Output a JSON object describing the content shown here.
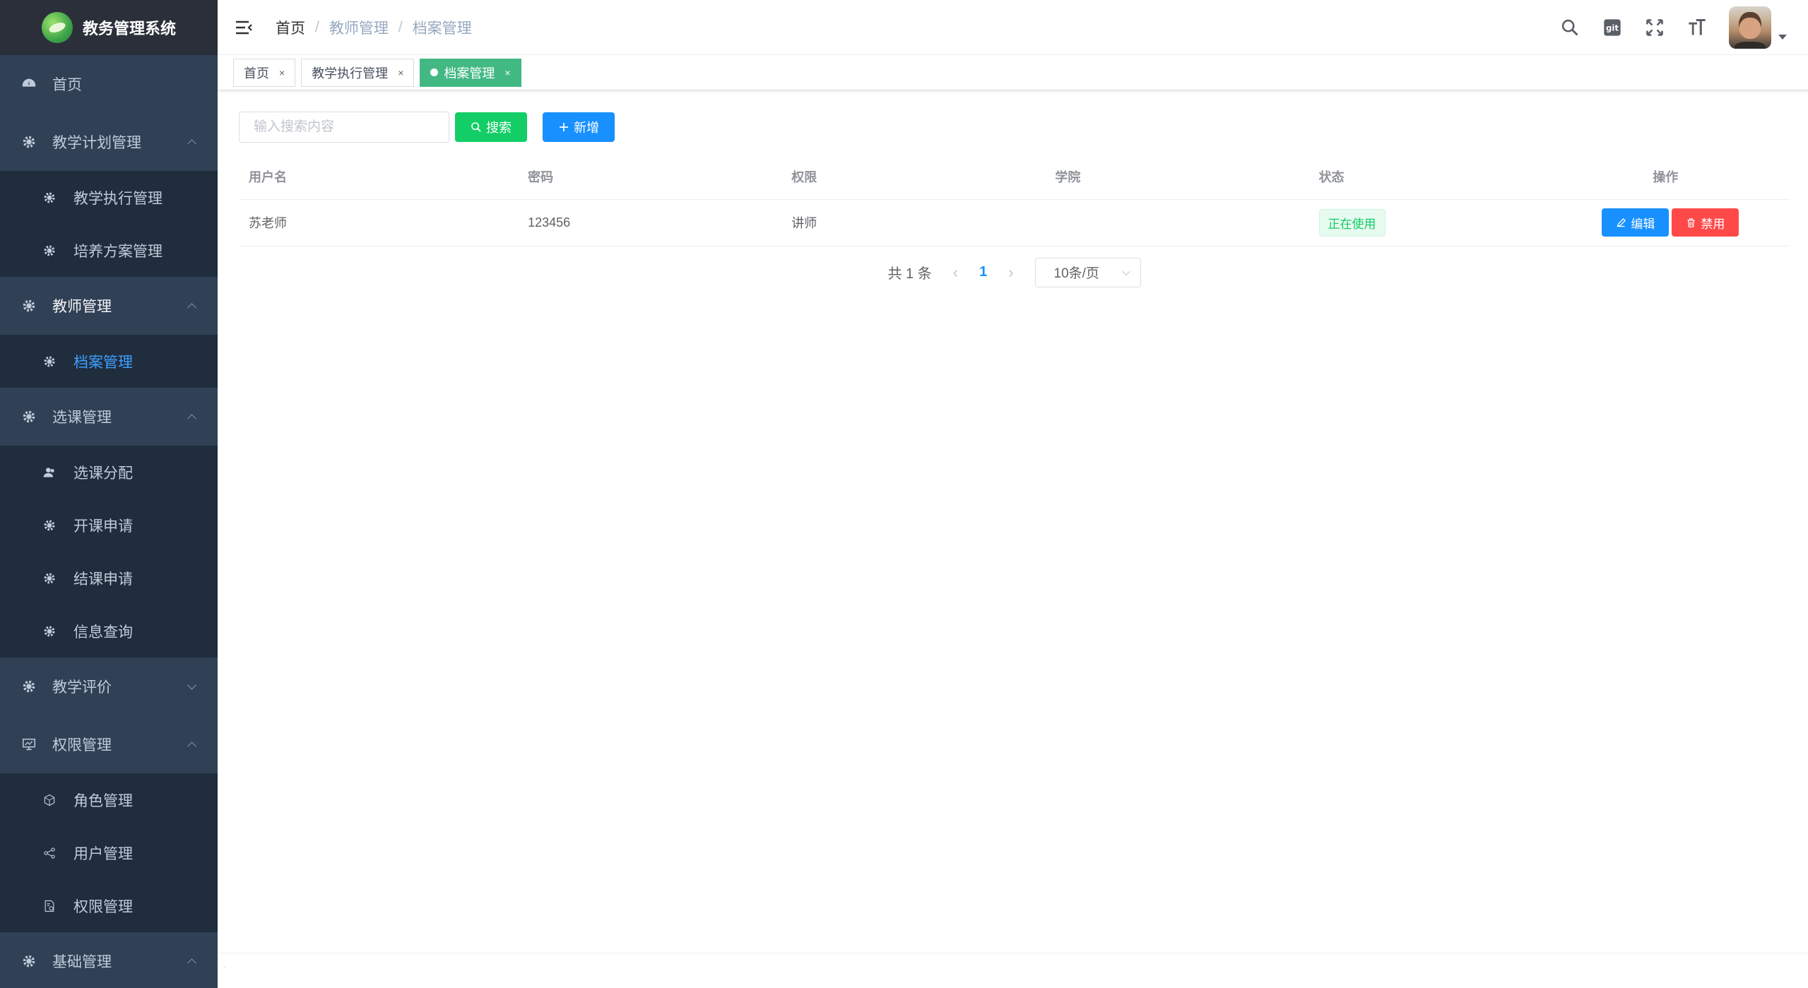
{
  "app": {
    "title": "教务管理系统"
  },
  "sidebar": {
    "items": [
      {
        "label": "首页"
      },
      {
        "label": "教学计划管理",
        "children": [
          {
            "label": "教学执行管理"
          },
          {
            "label": "培养方案管理"
          }
        ]
      },
      {
        "label": "教师管理",
        "children": [
          {
            "label": "档案管理"
          }
        ]
      },
      {
        "label": "选课管理",
        "children": [
          {
            "label": "选课分配"
          },
          {
            "label": "开课申请"
          },
          {
            "label": "结课申请"
          },
          {
            "label": "信息查询"
          }
        ]
      },
      {
        "label": "教学评价"
      },
      {
        "label": "权限管理",
        "children": [
          {
            "label": "角色管理"
          },
          {
            "label": "用户管理"
          },
          {
            "label": "权限管理"
          }
        ]
      },
      {
        "label": "基础管理"
      }
    ]
  },
  "breadcrumb": {
    "items": [
      "首页",
      "教师管理",
      "档案管理"
    ],
    "separator": "/"
  },
  "tags": [
    {
      "label": "首页",
      "close": "×"
    },
    {
      "label": "教学执行管理",
      "close": "×"
    },
    {
      "label": "档案管理",
      "close": "×"
    }
  ],
  "filter": {
    "search_placeholder": "输入搜索内容",
    "search_label": "搜索",
    "add_label": "新增"
  },
  "table": {
    "columns": [
      "用户名",
      "密码",
      "权限",
      "学院",
      "状态",
      "操作"
    ],
    "rows": [
      {
        "username": "苏老师",
        "password": "123456",
        "role": "讲师",
        "college": "",
        "status": "正在使用",
        "edit": "编辑",
        "disable": "禁用"
      }
    ]
  },
  "pagination": {
    "total": "共 1 条",
    "current": "1",
    "page_size": "10条/页"
  },
  "footer": {
    "text": "-"
  },
  "colors": {
    "sidebar_bg": "#304156",
    "active_menu": "#409eff",
    "tag_active": "#42b983",
    "primary": "#1890ff",
    "success": "#13ce66",
    "danger": "#ff4949"
  }
}
